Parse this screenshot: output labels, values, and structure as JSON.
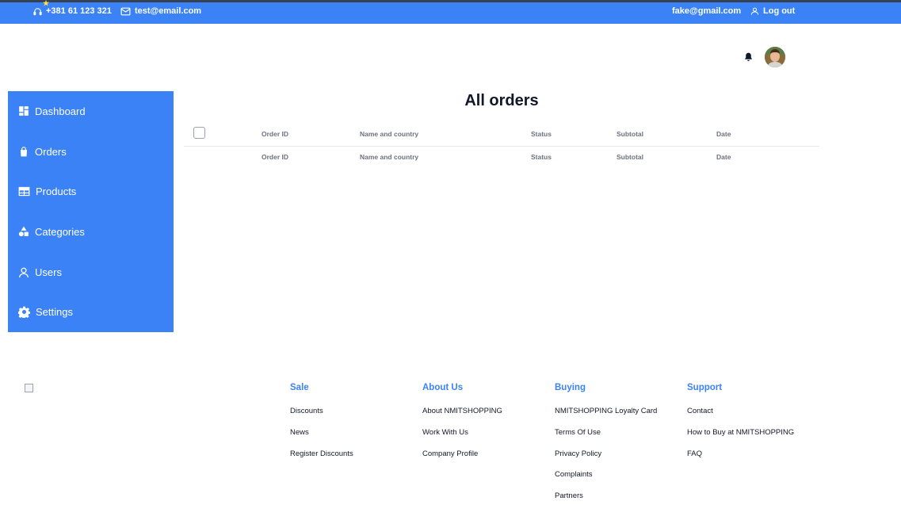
{
  "topbar": {
    "phone": "+381 61 123 321",
    "email": "test@email.com",
    "user_email": "fake@gmail.com",
    "logout_label": "Log out"
  },
  "header": {
    "notification_icon": "bell-icon",
    "avatar": "user-avatar"
  },
  "sidebar": {
    "items": [
      {
        "label": "Dashboard",
        "icon": "dashboard-icon"
      },
      {
        "label": "Orders",
        "icon": "shopping-bag-icon"
      },
      {
        "label": "Products",
        "icon": "table-icon"
      },
      {
        "label": "Categories",
        "icon": "shapes-icon"
      },
      {
        "label": "Users",
        "icon": "user-icon"
      },
      {
        "label": "Settings",
        "icon": "gear-icon"
      }
    ]
  },
  "main": {
    "title": "All orders",
    "columns": [
      "Order ID",
      "Name and country",
      "Status",
      "Subtotal",
      "Date"
    ],
    "footer_columns": [
      "Order ID",
      "Name and country",
      "Status",
      "Subtotal",
      "Date"
    ]
  },
  "footer": {
    "columns": [
      {
        "title": "Sale",
        "links": [
          "Discounts",
          "News",
          "Register Discounts"
        ]
      },
      {
        "title": "About Us",
        "links": [
          "About NMITSHOPPING",
          "Work With Us",
          "Company Profile"
        ]
      },
      {
        "title": "Buying",
        "links": [
          "NMITSHOPPING Loyalty Card",
          "Terms Of Use",
          "Privacy Policy",
          "Complaints",
          "Partners"
        ]
      },
      {
        "title": "Support",
        "links": [
          "Contact",
          "How to Buy at NMITSHOPPING",
          "FAQ"
        ]
      }
    ]
  },
  "colors": {
    "accent": "#3b82f6",
    "topbar_border": "#374151"
  }
}
